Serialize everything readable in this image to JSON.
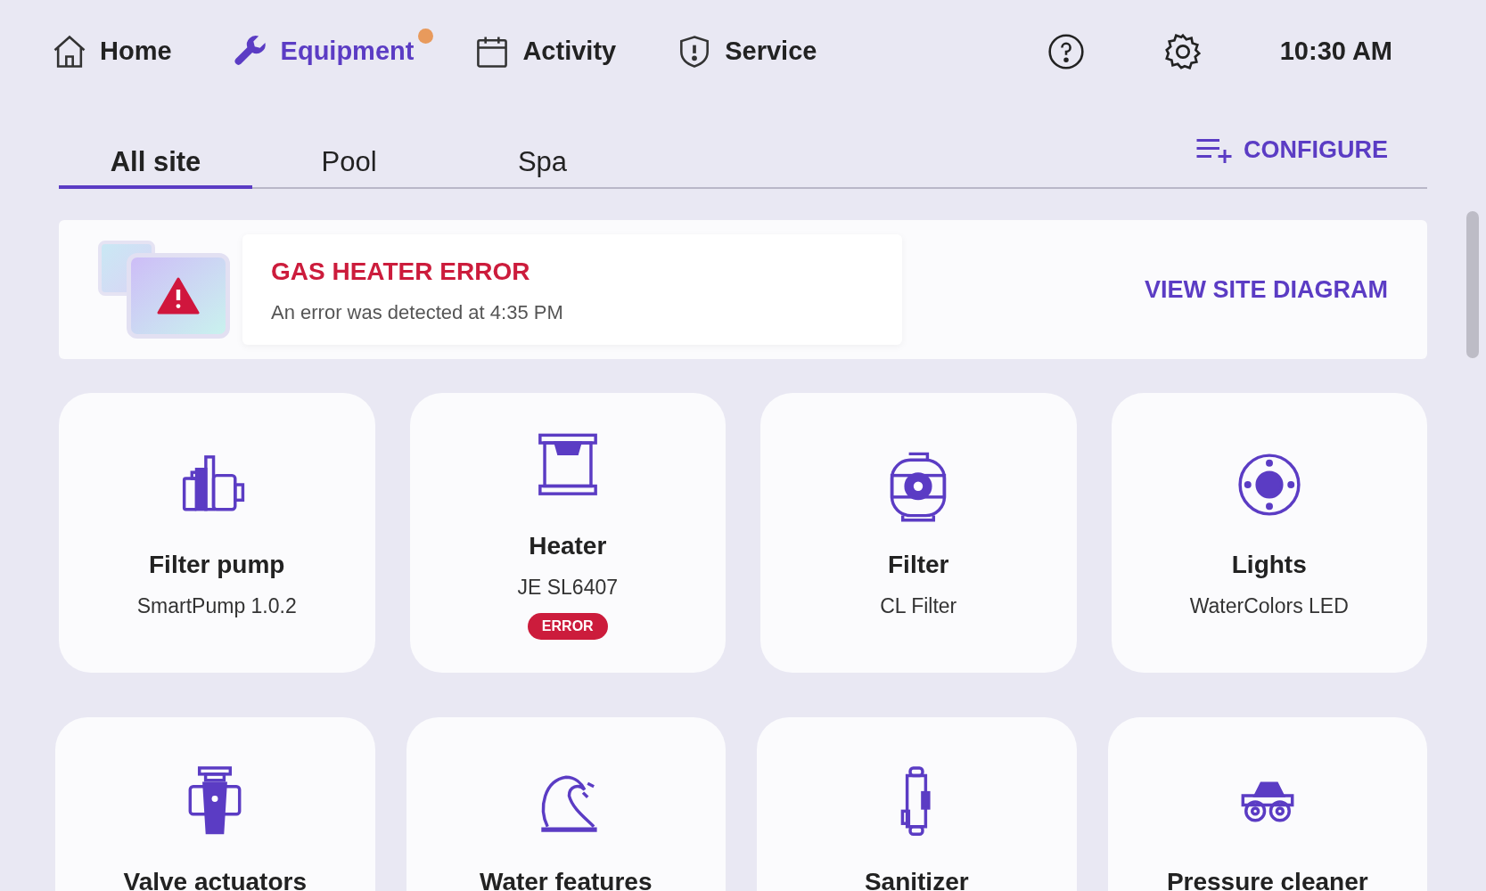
{
  "nav": [
    {
      "label": "Home",
      "selected": false,
      "notification": false
    },
    {
      "label": "Equipment",
      "selected": true,
      "notification": true
    },
    {
      "label": "Activity",
      "selected": false,
      "notification": false
    },
    {
      "label": "Service",
      "selected": false,
      "notification": false
    }
  ],
  "clock": "10:30 AM",
  "tabs": [
    {
      "label": "All site",
      "selected": true
    },
    {
      "label": "Pool",
      "selected": false
    },
    {
      "label": "Spa",
      "selected": false
    }
  ],
  "configure": "CONFIGURE",
  "alert": {
    "title": "GAS HEATER ERROR",
    "message": "An error was detected at 4:35 PM",
    "action": "VIEW SITE DIAGRAM"
  },
  "equipment": [
    {
      "kind": "pump",
      "name": "Filter pump",
      "model": "SmartPump 1.0.2"
    },
    {
      "kind": "heater",
      "name": "Heater",
      "model": "JE SL6407",
      "badge": "ERROR"
    },
    {
      "kind": "filter",
      "name": "Filter",
      "model": "CL Filter"
    },
    {
      "kind": "light",
      "name": "Lights",
      "model": "WaterColors LED"
    },
    {
      "kind": "valve",
      "name": "Valve actuators"
    },
    {
      "kind": "water",
      "name": "Water features"
    },
    {
      "kind": "sanitizer",
      "name": "Sanitizer"
    },
    {
      "kind": "cleaner",
      "name": "Pressure cleaner"
    }
  ]
}
